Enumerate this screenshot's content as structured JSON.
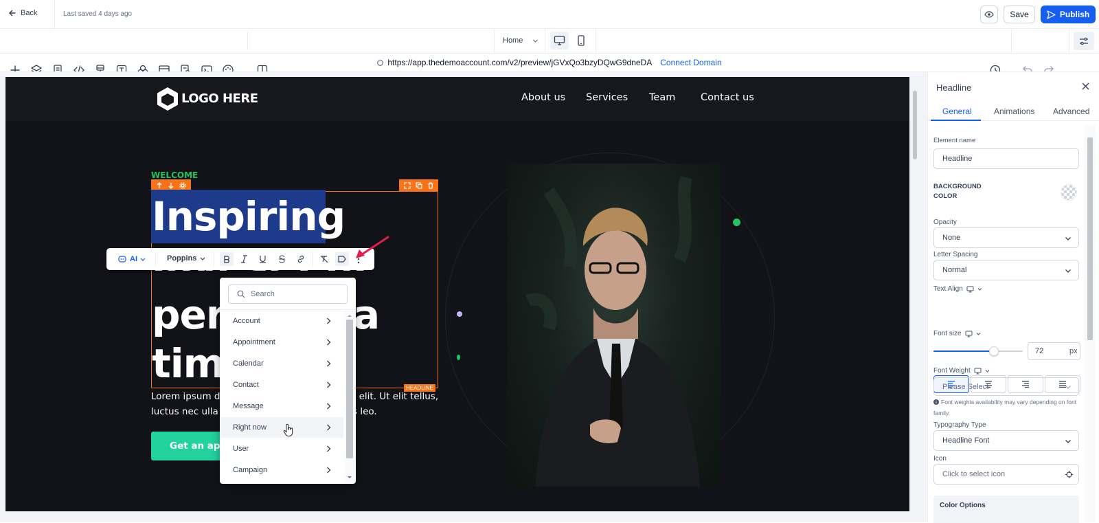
{
  "topbar": {
    "back_label": "Back",
    "last_saved": "Last saved 4 days ago",
    "save_label": "Save",
    "publish_label": "Publish"
  },
  "toolbar": {
    "page_select": "Home",
    "icons": [
      "plus-icon",
      "layers-icon",
      "page-icon",
      "code-icon",
      "brush-icon",
      "text-icon",
      "shapes-icon",
      "section-icon",
      "form-icon",
      "terminal-icon",
      "palette-icon",
      "split-view-icon"
    ]
  },
  "urlbar": {
    "url": "https://app.thedemoaccount.com/v2/preview/jGVxQo3bzyDQwG9dneDA",
    "connect_label": "Connect Domain"
  },
  "site": {
    "logo_text": "LOGO HERE",
    "nav": [
      "About us",
      "Services",
      "Team",
      "Contact us"
    ],
    "welcome": "WELCOME",
    "headline_line1": "Inspiring",
    "headline_line2": "invest ent",
    "headline_line3": "per",
    "headline_line3b": "a",
    "headline_line4": "tim",
    "body_left1": "Lorem ipsum d",
    "body_right1": "cing elit. Ut elit tellus,",
    "body_left2": "luctus nec ulla",
    "body_right2": "s leo.",
    "cta_label": "Get an app",
    "headline_tag": "HEADLINE"
  },
  "context_toolbar": {
    "ai_label": "AI",
    "font_label": "Poppins"
  },
  "dropdown": {
    "search_placeholder": "Search",
    "items": [
      "Account",
      "Appointment",
      "Calendar",
      "Contact",
      "Message",
      "Right now",
      "User",
      "Campaign"
    ],
    "hovered": "Right now"
  },
  "sidebar": {
    "title": "Headline",
    "tabs": [
      "General",
      "Animations",
      "Advanced"
    ],
    "active_tab": "General",
    "element_name_label": "Element name",
    "element_name_value": "Headline",
    "bg_color_label_1": "BACKGROUND",
    "bg_color_label_2": "COLOR",
    "opacity_label": "Opacity",
    "opacity_value": "None",
    "letter_spacing_label": "Letter Spacing",
    "letter_spacing_value": "Normal",
    "text_align_label": "Text Align",
    "font_size_label": "Font size",
    "font_size_value": "72",
    "font_size_unit": "px",
    "font_size_slider_fraction": 0.7,
    "font_weight_label": "Font Weight",
    "font_weight_placeholder": "Please Select",
    "font_weight_note_1": "Font weights availability may vary depending on font",
    "font_weight_note_2": "family.",
    "typography_label": "Typography Type",
    "typography_value": "Headline Font",
    "icon_label": "Icon",
    "icon_placeholder": "Click to select icon",
    "color_options_label": "Color Options"
  },
  "colors": {
    "accent_blue": "#155eef",
    "publish_bg": "#155eef",
    "selection_orange": "#f97316",
    "highlight": "#1e3a8a",
    "brand_green": "#22c55e",
    "cta_green": "#22d3a0"
  }
}
